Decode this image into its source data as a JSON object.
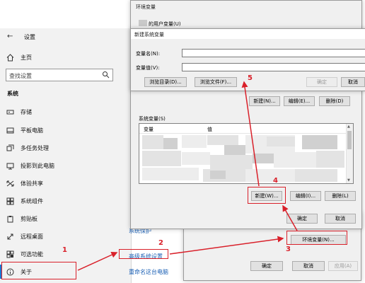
{
  "settings": {
    "title": "设置",
    "home_label": "主页",
    "search_placeholder": "查找设置",
    "section_label": "系统",
    "nav_items": [
      {
        "label": "存储",
        "icon": "storage-icon"
      },
      {
        "label": "平板电脑",
        "icon": "tablet-icon"
      },
      {
        "label": "多任务处理",
        "icon": "multitasking-icon"
      },
      {
        "label": "投影到此电脑",
        "icon": "projection-icon"
      },
      {
        "label": "体验共享",
        "icon": "shared-experiences-icon"
      },
      {
        "label": "系统组件",
        "icon": "system-components-icon"
      },
      {
        "label": "剪贴板",
        "icon": "clipboard-icon"
      },
      {
        "label": "远程桌面",
        "icon": "remote-desktop-icon"
      },
      {
        "label": "可选功能",
        "icon": "optional-features-icon"
      },
      {
        "label": "关于",
        "icon": "info-icon"
      }
    ],
    "related_links": [
      "系统保护",
      "高级系统设置",
      "重命名这台电脑"
    ]
  },
  "env_dialog": {
    "title": "环境变量",
    "user_vars_label": "的用户变量(U)",
    "user_buttons": [
      "新建(N)...",
      "编辑(E)...",
      "删除(D)"
    ],
    "system_vars_label": "系统变量(S)",
    "columns": [
      "变量",
      "值"
    ],
    "system_buttons": [
      "新建(W)...",
      "编辑(I)...",
      "删除(L)"
    ],
    "ok": "确定",
    "cancel": "取消"
  },
  "new_var_dialog": {
    "title": "新建系统变量",
    "name_label": "变量名(N):",
    "value_label": "变量值(V):",
    "name_value": "",
    "value_value": "",
    "browse_dir": "浏览目录(D)...",
    "browse_file": "浏览文件(F)...",
    "ok": "确定",
    "cancel": "取消"
  },
  "sys_props": {
    "env_button": "环境变量(N)...",
    "ok": "确定",
    "cancel": "取消",
    "apply": "应用(A)"
  },
  "annotations": [
    "1",
    "2",
    "3",
    "4",
    "5"
  ],
  "colors": {
    "annotation": "#d9202a",
    "link": "#1a5fb4",
    "accent": "#1b76d1"
  }
}
